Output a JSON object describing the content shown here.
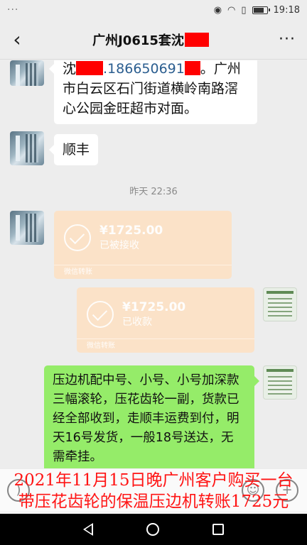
{
  "status_bar": {
    "dots": "···",
    "time": "19:18",
    "icons": [
      "eye-icon",
      "wifi-icon",
      "sim-icon",
      "battery-icon"
    ],
    "battery_level": 0.85
  },
  "header": {
    "title": "广州J0615套沈",
    "back_icon": "back-chevron-icon",
    "more_icon": "more-icon"
  },
  "messages": {
    "m1": {
      "name_prefix": "沈",
      "phone": ".186650691",
      "rest": "。广州市白云区石门街道横岭南路滘心公园金旺超市对面。"
    },
    "m2": {
      "text": "顺丰"
    },
    "timestamp": "昨天 22:36",
    "pay1": {
      "amount": "¥1725.00",
      "status": "已被接收",
      "footer": "微信转账"
    },
    "pay2": {
      "amount": "¥1725.00",
      "status": "已收款",
      "footer": "微信转账"
    },
    "m3": {
      "text": "压边机配中号、小号、小号加深款三幅滚轮，压花齿轮一副，货款已经全部收到，走顺丰运费到付，明天16号发货，一般18号送达，无需牵挂。"
    }
  },
  "caption": {
    "line1": "2021年11月15日晚广州客户购买一台",
    "line2": "带压花齿轮的保温压边机转账1725元"
  },
  "colors": {
    "chat_bg": "#ededed",
    "bubble_green": "#95ec69",
    "transfer_bg": "#fbe2c8",
    "caption_red": "#ff1414",
    "redact_red": "#ff0000"
  }
}
